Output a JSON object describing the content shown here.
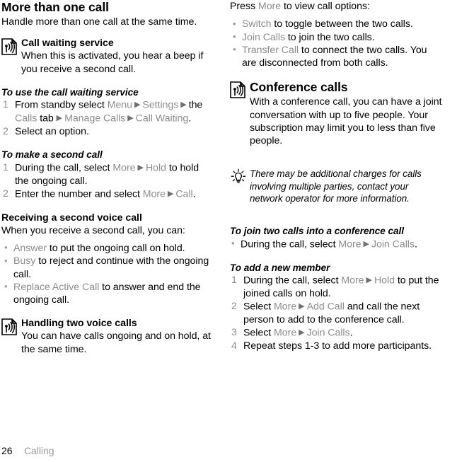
{
  "page": {
    "number": "26",
    "section": "Calling"
  },
  "left_column": {
    "title": "More than one call",
    "intro": "Handle more than one call at the same time.",
    "call_waiting": {
      "icon": "radio-waves-document-icon",
      "heading": "Call waiting service",
      "body": "When this is activated, you hear a beep if you receive a second call."
    },
    "proc_use_call_waiting": {
      "heading": "To use the call waiting service",
      "steps": [
        {
          "parts": [
            {
              "type": "plain",
              "text": "From standby select "
            },
            {
              "type": "ui",
              "text": "Menu"
            },
            {
              "type": "arrow",
              "text": "▶"
            },
            {
              "type": "ui",
              "text": "Settings"
            },
            {
              "type": "arrow",
              "text": "▶"
            },
            {
              "type": "plain",
              "text": "the "
            },
            {
              "type": "ui",
              "text": "Calls"
            },
            {
              "type": "plain",
              "text": " tab "
            },
            {
              "type": "arrow",
              "text": "▶"
            },
            {
              "type": "ui",
              "text": "Manage Calls"
            },
            {
              "type": "arrow",
              "text": "▶"
            },
            {
              "type": "ui",
              "text": "Call Waiting"
            },
            {
              "type": "plain",
              "text": "."
            }
          ]
        },
        {
          "parts": [
            {
              "type": "plain",
              "text": "Select an option."
            }
          ]
        }
      ]
    },
    "proc_make_second_call": {
      "heading": "To make a second call",
      "steps": [
        {
          "parts": [
            {
              "type": "plain",
              "text": "During the call, select "
            },
            {
              "type": "ui",
              "text": "More"
            },
            {
              "type": "arrow",
              "text": "▶"
            },
            {
              "type": "ui",
              "text": "Hold"
            },
            {
              "type": "plain",
              "text": " to hold the ongoing call."
            }
          ]
        },
        {
          "parts": [
            {
              "type": "plain",
              "text": "Enter the number and select "
            },
            {
              "type": "ui",
              "text": "More"
            },
            {
              "type": "arrow",
              "text": "▶"
            },
            {
              "type": "ui",
              "text": "Call"
            },
            {
              "type": "plain",
              "text": "."
            }
          ]
        }
      ]
    },
    "receiving_second": {
      "heading": "Receiving a second voice call",
      "body": "When you receive a second call, you can:",
      "bullets": [
        {
          "parts": [
            {
              "type": "ui",
              "text": "Answer"
            },
            {
              "type": "plain",
              "text": " to put the ongoing call on hold."
            }
          ]
        },
        {
          "parts": [
            {
              "type": "ui",
              "text": "Busy"
            },
            {
              "type": "plain",
              "text": " to reject and continue with the ongoing call."
            }
          ]
        },
        {
          "parts": [
            {
              "type": "ui",
              "text": "Replace Active Call"
            },
            {
              "type": "plain",
              "text": " to answer and end the ongoing call."
            }
          ]
        }
      ]
    },
    "handling_two": {
      "icon": "radio-waves-document-icon",
      "heading": "Handling two voice calls",
      "body": "You can have calls ongoing and on hold, at the same time."
    }
  },
  "right_column": {
    "press_more": {
      "parts": [
        {
          "type": "plain",
          "text": "Press "
        },
        {
          "type": "ui",
          "text": "More"
        },
        {
          "type": "plain",
          "text": " to view call options:"
        }
      ]
    },
    "more_options": [
      {
        "parts": [
          {
            "type": "ui",
            "text": "Switch"
          },
          {
            "type": "plain",
            "text": " to toggle between the two calls."
          }
        ]
      },
      {
        "parts": [
          {
            "type": "ui",
            "text": "Join Calls"
          },
          {
            "type": "plain",
            "text": " to join the two calls."
          }
        ]
      },
      {
        "parts": [
          {
            "type": "ui",
            "text": "Transfer Call"
          },
          {
            "type": "plain",
            "text": " to connect the two calls. You are disconnected from both calls."
          }
        ]
      }
    ],
    "conference": {
      "icon": "radio-waves-document-icon",
      "heading": "Conference calls",
      "body": "With a conference call, you can have a joint conversation with up to five people. Your subscription may limit you to less than five people."
    },
    "tip": {
      "icon": "lightbulb-tip-icon",
      "text": "There may be additional charges for calls involving multiple parties, contact your network operator for more information."
    },
    "proc_join_two": {
      "heading": "To join two calls into a conference call",
      "bullets": [
        {
          "parts": [
            {
              "type": "plain",
              "text": "During the call, select "
            },
            {
              "type": "ui",
              "text": "More"
            },
            {
              "type": "arrow",
              "text": "▶"
            },
            {
              "type": "ui",
              "text": "Join Calls"
            },
            {
              "type": "plain",
              "text": "."
            }
          ]
        }
      ]
    },
    "proc_add_member": {
      "heading": "To add a new member",
      "steps": [
        {
          "parts": [
            {
              "type": "plain",
              "text": "During the call, select "
            },
            {
              "type": "ui",
              "text": "More"
            },
            {
              "type": "arrow",
              "text": "▶"
            },
            {
              "type": "ui",
              "text": "Hold"
            },
            {
              "type": "plain",
              "text": " to put the joined calls on hold."
            }
          ]
        },
        {
          "parts": [
            {
              "type": "plain",
              "text": "Select "
            },
            {
              "type": "ui",
              "text": "More"
            },
            {
              "type": "arrow",
              "text": "▶"
            },
            {
              "type": "ui",
              "text": "Add Call"
            },
            {
              "type": "plain",
              "text": " and call the next person to add to the conference call."
            }
          ]
        },
        {
          "parts": [
            {
              "type": "plain",
              "text": "Select "
            },
            {
              "type": "ui",
              "text": "More"
            },
            {
              "type": "arrow",
              "text": "▶"
            },
            {
              "type": "ui",
              "text": "Join Calls"
            },
            {
              "type": "plain",
              "text": "."
            }
          ]
        },
        {
          "parts": [
            {
              "type": "plain",
              "text": "Repeat steps 1-3 to add more participants."
            }
          ]
        }
      ]
    }
  },
  "colors": {
    "ui_reference": "#8c8c8c",
    "body_text": "#000000",
    "footer_section": "#9a9a9a"
  }
}
